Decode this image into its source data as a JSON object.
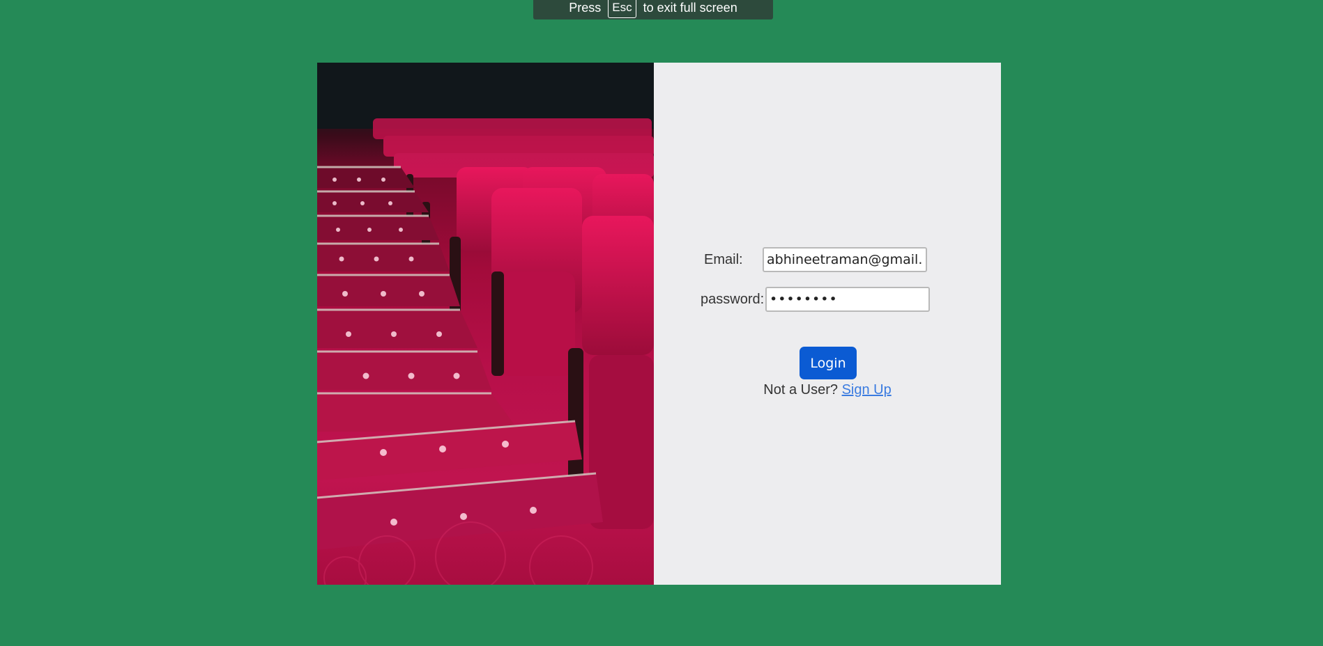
{
  "fullscreen_notice": {
    "prefix": "Press",
    "key": "Esc",
    "suffix": "to exit full screen"
  },
  "hero_image": {
    "icon": "cinema-seats-photo"
  },
  "login_form": {
    "email_label": "Email:",
    "email_value": "abhineetraman@gmail.co",
    "password_label": "password:",
    "password_value": "••••••••",
    "login_label": "Login",
    "signup_prompt": "Not a User?",
    "signup_link": "Sign Up"
  },
  "colors": {
    "background": "#258a57",
    "panel": "#ededef",
    "button": "#0b5bd3",
    "link": "#3a7be0"
  }
}
